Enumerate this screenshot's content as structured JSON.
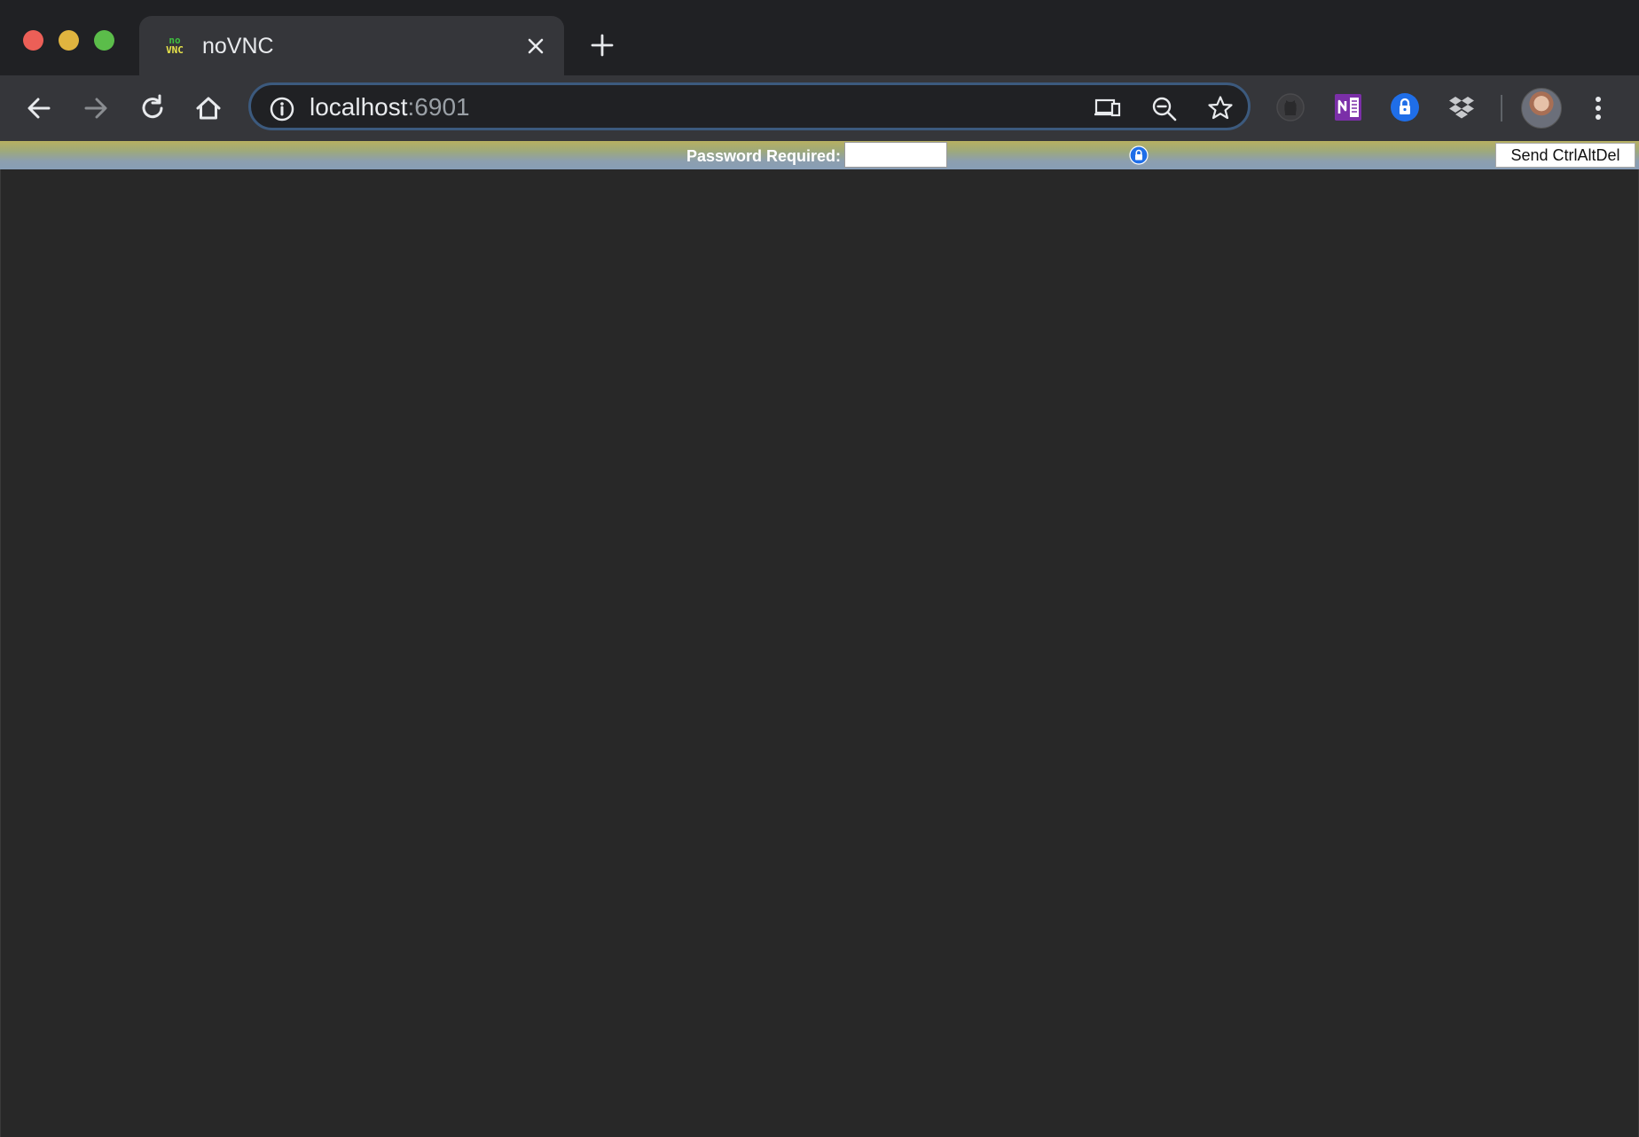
{
  "browser": {
    "tab": {
      "title": "noVNC",
      "favicon_top": "no",
      "favicon_bottom": "VNC",
      "favicon_icon": "novnc-favicon-icon",
      "close_icon": "close-icon"
    },
    "new_tab_icon": "plus-icon",
    "nav": {
      "back_icon": "arrow-left-icon",
      "forward_icon": "arrow-right-icon",
      "reload_icon": "reload-icon",
      "home_icon": "home-icon"
    },
    "omnibox": {
      "host": "localhost",
      "port": ":6901",
      "info_icon": "info-icon",
      "cast_icon": "cast-devices-icon",
      "zoom_icon": "zoom-out-icon",
      "bookmark_icon": "star-icon"
    },
    "extensions": [
      "github-icon",
      "onenote-icon",
      "password-lock-icon",
      "dropbox-icon"
    ],
    "menu_icon": "kebab-menu-icon",
    "colors": {
      "frame": "#202124",
      "toolbar": "#35363a",
      "omnibox_border": "#3c5a7e"
    }
  },
  "novnc": {
    "status_label": "Password Required:",
    "password_value": "",
    "ctrl_alt_del_label": "Send CtrlAltDel",
    "canvas_color": "#282828"
  }
}
